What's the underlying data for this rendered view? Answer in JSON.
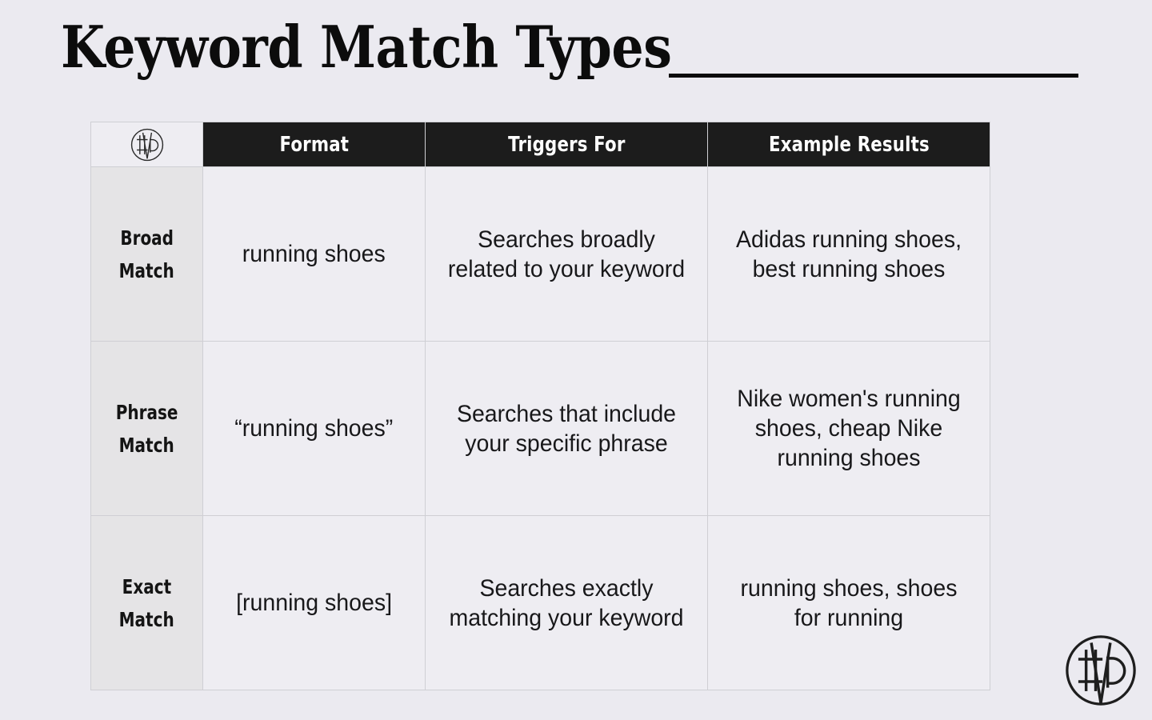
{
  "slide": {
    "title": "Keyword Match Types",
    "background_color": "#ebeaf0",
    "accent_dark": "#1c1c1c",
    "rule_color": "#0c0c0c"
  },
  "brand": {
    "logo_icon": "imd-monogram-circle-logo",
    "logo_header_icon": "imd-monogram-circle-logo"
  },
  "table": {
    "headers": {
      "col1": "",
      "col2": "Format",
      "col3": "Triggers For",
      "col4": "Example Results"
    },
    "rows": [
      {
        "type": "Broad Match",
        "type_line1": "Broad",
        "type_line2": "Match",
        "format": "running shoes",
        "triggers_for": "Searches broadly related to your keyword",
        "example_results": "Adidas running shoes, best running shoes"
      },
      {
        "type": "Phrase Match",
        "type_line1": "Phrase",
        "type_line2": "Match",
        "format": "“running shoes”",
        "triggers_for": "Searches that include your specific phrase",
        "example_results": "Nike women's running shoes, cheap Nike running shoes"
      },
      {
        "type": "Exact Match",
        "type_line1": "Exact",
        "type_line2": "Match",
        "format": "[running shoes]",
        "triggers_for": "Searches exactly matching your keyword",
        "example_results": "running shoes, shoes for running"
      }
    ]
  }
}
